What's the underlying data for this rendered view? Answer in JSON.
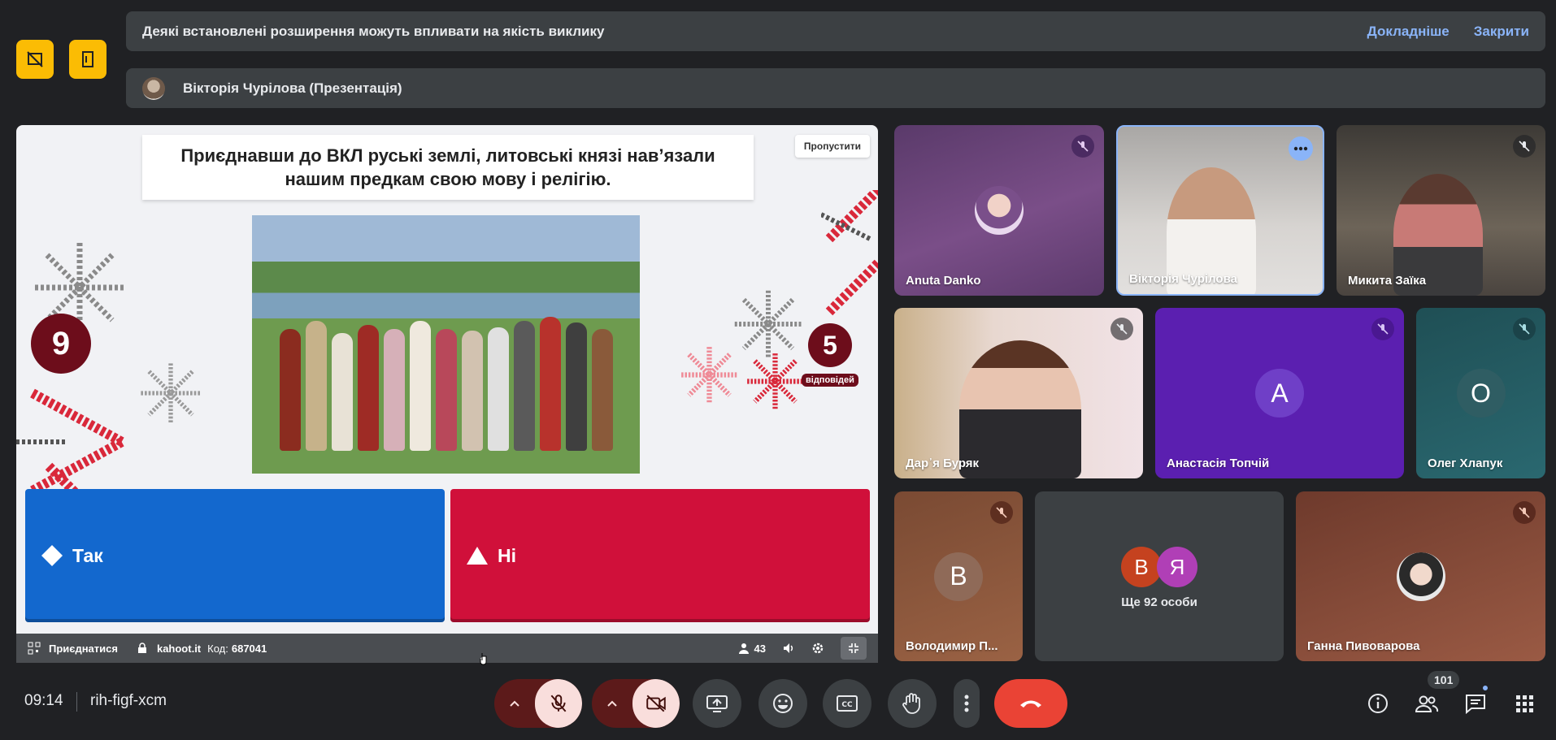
{
  "banner": {
    "warning_text": "Деякі встановлені розширення можуть впливати на якість виклику",
    "learn_more": "Докладніше",
    "close": "Закрити",
    "presenter_text": "Вікторія Чурілова (Презентація)"
  },
  "presentation": {
    "question": "Приєднавши до ВКЛ руські  землі, литовські князі нав’язали нашим предкам свою мову і релігію.",
    "skip_label": "Пропустити",
    "timer": "9",
    "answers_count": "5",
    "answers_label": "відповідей",
    "answer_yes": "Так",
    "answer_no": "Ні",
    "bar": {
      "join_label": "Приєднатися",
      "site": "kahoot.it",
      "code_label": "Код:",
      "code": "687041",
      "players": "43"
    }
  },
  "tiles": [
    {
      "name": "Anuta Danko"
    },
    {
      "name": "Вікторія Чурілова"
    },
    {
      "name": "Микита Заїка"
    },
    {
      "name": "Дар᾽я Буряк"
    },
    {
      "name": "Анастасія Топчій",
      "initial": "А"
    },
    {
      "name": "Олег Хлапук",
      "initial": "О"
    },
    {
      "name": "Володимир П...",
      "initial": "В"
    },
    {
      "more_text": "Ще 92 особи",
      "initials": [
        "В",
        "Я"
      ]
    },
    {
      "name": "Ганна Пивоварова"
    }
  ],
  "bottom": {
    "time": "09:14",
    "meeting_code": "rih-figf-xcm",
    "participants_count": "101"
  },
  "colors": {
    "accent_yellow": "#fbbc04",
    "hangup_red": "#ea4335",
    "answer_blue": "#1368ce",
    "answer_red": "#d0103a"
  }
}
